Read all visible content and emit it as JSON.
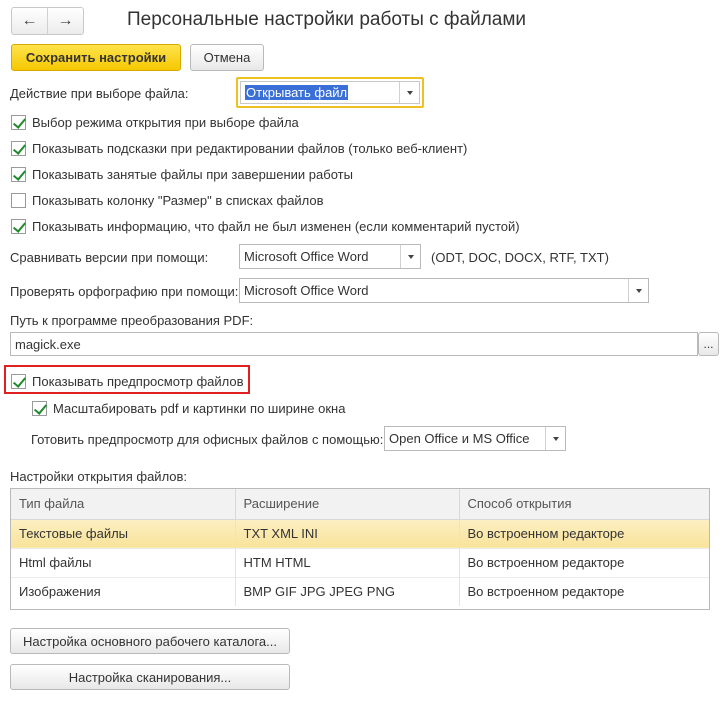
{
  "window": {
    "title": "Персональные настройки работы с файлами"
  },
  "nav": {
    "back_icon": "←",
    "forward_icon": "→"
  },
  "toolbar": {
    "save_label": "Сохранить настройки",
    "cancel_label": "Отмена"
  },
  "file_action": {
    "label": "Действие при выборе файла:",
    "value": "Открывать файл"
  },
  "checkboxes": [
    {
      "label": "Выбор режима открытия при выборе файла",
      "checked": true
    },
    {
      "label": "Показывать подсказки при редактировании файлов (только веб-клиент)",
      "checked": true
    },
    {
      "label": "Показывать занятые файлы при завершении работы",
      "checked": true
    },
    {
      "label": "Показывать колонку \"Размер\" в списках файлов",
      "checked": false
    },
    {
      "label": "Показывать информацию, что файл не был изменен  (если комментарий пустой)",
      "checked": true
    }
  ],
  "compare": {
    "label": "Сравнивать версии при помощи:",
    "value": "Microsoft Office Word",
    "hint": "(ODT, DOC, DOCX, RTF, TXT)"
  },
  "spell": {
    "label": "Проверять орфографию при помощи:",
    "value": "Microsoft Office Word"
  },
  "pdf": {
    "label": "Путь к программе преобразования PDF:",
    "value": "magick.exe",
    "browse_label": "..."
  },
  "preview": {
    "label": "Показывать предпросмотр файлов",
    "checked": true,
    "scale_label": "Масштабировать pdf и картинки по ширине окна",
    "scale_checked": true,
    "office_label": "Готовить предпросмотр для офисных файлов с помощью:",
    "office_value": "Open Office и MS Office"
  },
  "open_settings": {
    "label": "Настройки открытия файлов:",
    "columns": [
      "Тип файла",
      "Расширение",
      "Способ открытия"
    ],
    "rows": [
      [
        "Текстовые файлы",
        "TXT XML INI",
        "Во встроенном редакторе"
      ],
      [
        "Html файлы",
        "HTM HTML",
        "Во встроенном редакторе"
      ],
      [
        "Изображения",
        "BMP GIF JPG JPEG PNG",
        "Во встроенном редакторе"
      ]
    ]
  },
  "bottom_buttons": {
    "catalog_label": "Настройка основного рабочего каталога...",
    "scan_label": "Настройка сканирования..."
  }
}
